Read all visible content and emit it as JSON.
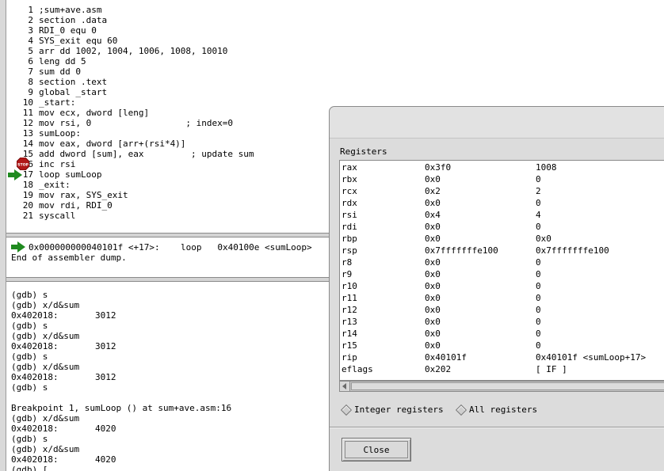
{
  "source": {
    "lines": [
      {
        "no": "1",
        "code": ";sum+ave.asm"
      },
      {
        "no": "2",
        "code": "section .data"
      },
      {
        "no": "3",
        "code": "RDI_0 equ 0"
      },
      {
        "no": "4",
        "code": "SYS_exit equ 60"
      },
      {
        "no": "5",
        "code": "arr dd 1002, 1004, 1006, 1008, 10010"
      },
      {
        "no": "6",
        "code": "leng dd 5"
      },
      {
        "no": "7",
        "code": "sum dd 0"
      },
      {
        "no": "8",
        "code": "section .text"
      },
      {
        "no": "9",
        "code": "global _start"
      },
      {
        "no": "10",
        "code": "_start:"
      },
      {
        "no": "11",
        "code": "mov ecx, dword [leng]"
      },
      {
        "no": "12",
        "code": "mov rsi, 0                  ; index=0"
      },
      {
        "no": "13",
        "code": "sumLoop:"
      },
      {
        "no": "14",
        "code": "mov eax, dword [arr+(rsi*4)]"
      },
      {
        "no": "15",
        "code": "add dword [sum], eax         ; update sum"
      },
      {
        "no": "16",
        "code": "inc rsi"
      },
      {
        "no": "17",
        "code": "loop sumLoop"
      },
      {
        "no": "18",
        "code": "_exit:"
      },
      {
        "no": "19",
        "code": "mov rax, SYS_exit"
      },
      {
        "no": "20",
        "code": "mov rdi, RDI_0"
      },
      {
        "no": "21",
        "code": "syscall"
      }
    ],
    "breakpoint_icon": "stop-sign-icon",
    "breakpoint_label": "STOP",
    "current_line_icon": "green-arrow-icon"
  },
  "asm": {
    "current": "0x000000000040101f <+17>:    loop   0x40100e <sumLoop>",
    "end": "End of assembler dump."
  },
  "gdb": {
    "lines": [
      "(gdb) s",
      "(gdb) x/d&sum",
      "0x402018:       3012",
      "(gdb) s",
      "(gdb) x/d&sum",
      "0x402018:       3012",
      "(gdb) s",
      "(gdb) x/d&sum",
      "0x402018:       3012",
      "(gdb) s",
      "",
      "Breakpoint 1, sumLoop () at sum+ave.asm:16",
      "(gdb) x/d&sum",
      "0x402018:       4020",
      "(gdb) s",
      "(gdb) x/d&sum",
      "0x402018:       4020",
      "(gdb) ["
    ]
  },
  "registers": {
    "heading": "Registers",
    "rows": [
      {
        "name": "rax",
        "hex": "0x3f0",
        "natural": "1008"
      },
      {
        "name": "rbx",
        "hex": "0x0",
        "natural": "0"
      },
      {
        "name": "rcx",
        "hex": "0x2",
        "natural": "2"
      },
      {
        "name": "rdx",
        "hex": "0x0",
        "natural": "0"
      },
      {
        "name": "rsi",
        "hex": "0x4",
        "natural": "4"
      },
      {
        "name": "rdi",
        "hex": "0x0",
        "natural": "0"
      },
      {
        "name": "rbp",
        "hex": "0x0",
        "natural": "0x0"
      },
      {
        "name": "rsp",
        "hex": "0x7fffffffe100",
        "natural": "0x7fffffffe100"
      },
      {
        "name": "r8",
        "hex": "0x0",
        "natural": "0"
      },
      {
        "name": "r9",
        "hex": "0x0",
        "natural": "0"
      },
      {
        "name": "r10",
        "hex": "0x0",
        "natural": "0"
      },
      {
        "name": "r11",
        "hex": "0x0",
        "natural": "0"
      },
      {
        "name": "r12",
        "hex": "0x0",
        "natural": "0"
      },
      {
        "name": "r13",
        "hex": "0x0",
        "natural": "0"
      },
      {
        "name": "r14",
        "hex": "0x0",
        "natural": "0"
      },
      {
        "name": "r15",
        "hex": "0x0",
        "natural": "0"
      },
      {
        "name": "rip",
        "hex": "0x40101f",
        "natural": "0x40101f <sumLoop+17>"
      },
      {
        "name": "eflags",
        "hex": "0x202",
        "natural": "[ IF ]"
      }
    ],
    "radio_integer": "Integer registers",
    "radio_all": "All registers",
    "close_label": "Close"
  },
  "colors": {
    "arrow": "#1f8a1f",
    "stop": "#b01818"
  }
}
